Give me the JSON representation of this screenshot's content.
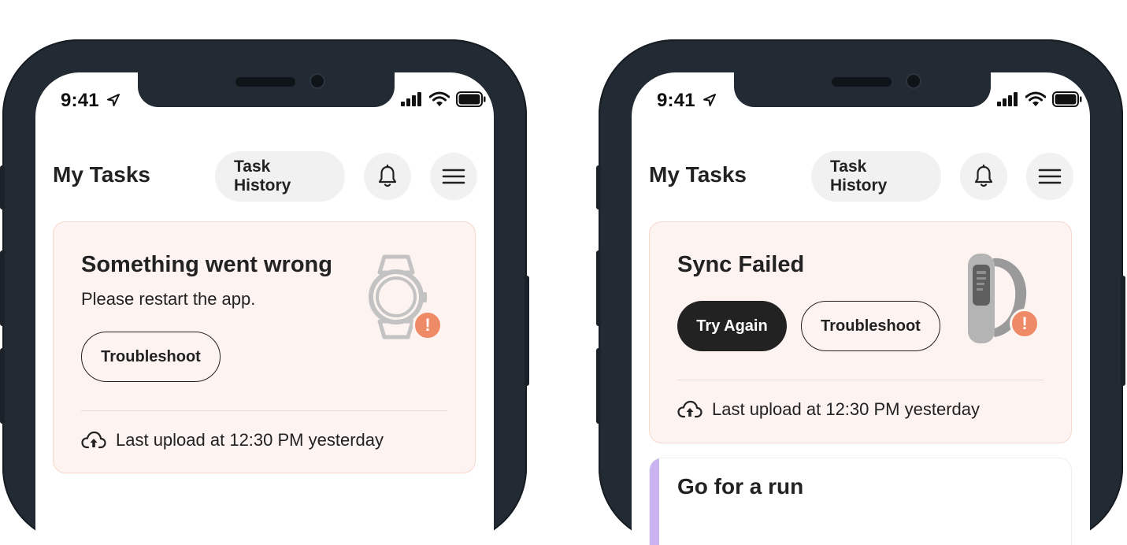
{
  "status_bar": {
    "time": "9:41"
  },
  "colors": {
    "alert_badge": "#ef8a67",
    "card_bg": "#fdf3f0",
    "card_border": "#f7d8cc",
    "accent_stripe": "#c9b4f1",
    "phone_frame": "#222a33"
  },
  "left_phone": {
    "header": {
      "title": "My Tasks",
      "task_history_label": "Task History",
      "bell_icon": "bell-icon",
      "menu_icon": "hamburger-menu-icon"
    },
    "alert_card": {
      "title": "Something went wrong",
      "message": "Please restart the app.",
      "troubleshoot_label": "Troubleshoot",
      "device_icon": "smartwatch-outline-icon",
      "badge": "!",
      "last_upload": "Last upload at 12:30 PM yesterday",
      "upload_icon": "cloud-upload-icon"
    }
  },
  "right_phone": {
    "header": {
      "title": "My Tasks",
      "task_history_label": "Task History",
      "bell_icon": "bell-icon",
      "menu_icon": "hamburger-menu-icon"
    },
    "alert_card": {
      "title": "Sync Failed",
      "try_again_label": "Try Again",
      "troubleshoot_label": "Troubleshoot",
      "device_icon": "fitness-band-icon",
      "badge": "!",
      "last_upload": "Last upload at 12:30 PM yesterday",
      "upload_icon": "cloud-upload-icon"
    },
    "next_task": {
      "title": "Go for a run"
    }
  }
}
